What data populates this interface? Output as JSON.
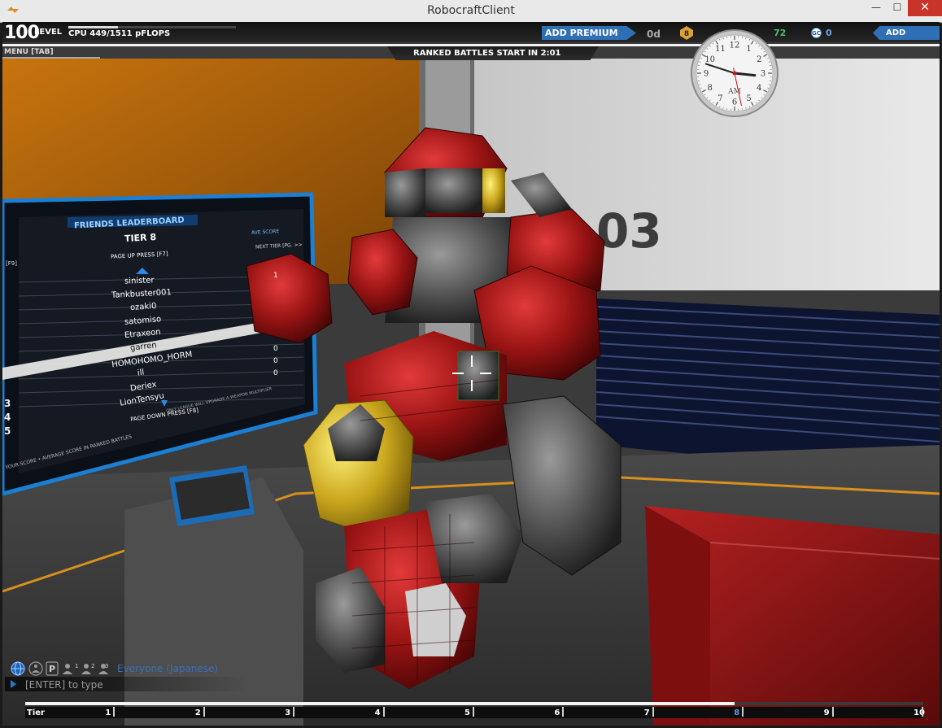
{
  "window": {
    "title": "RobocraftClient",
    "minimize_glyph": "—",
    "maximize_glyph": "☐",
    "close_glyph": "✕",
    "icon": "robocraft-app-icon"
  },
  "hud": {
    "level_number": "100",
    "level_label": "LEVEL",
    "cpu_text": "CPU 449/1511 pFLOPS",
    "cpu_used": 449,
    "cpu_max": 1511,
    "menu_label": "MENU [TAB]",
    "ranked_text": "RANKED BATTLES START IN  2:01",
    "add_premium_label": "ADD PREMIUM",
    "premium_days": "0d",
    "rank_badge_value": "8",
    "robits_value": "72",
    "gc_label": "GC",
    "gc_value": "0",
    "add_funds_label": "ADD FUNDS",
    "accent_color": "#2f6fb5"
  },
  "clock": {
    "label": "AM",
    "numerals": [
      "12",
      "1",
      "2",
      "3",
      "4",
      "5",
      "6",
      "7",
      "8",
      "9",
      "10",
      "11"
    ],
    "hour_hand_hour": 3.2,
    "minute_hand_minute": 48,
    "second_hand_second": 28
  },
  "scene_labels": {
    "wall_number": "03"
  },
  "leaderboard": {
    "title": "FRIENDS LEADERBOARD",
    "tier": "TIER 8",
    "avg_score_label": "AVE SCORE",
    "next_tier_label": "NEXT TIER [PG. >>",
    "page_up_label": "PAGE UP PRESS  [F7]",
    "f9_label": "[F9]",
    "page_down_label": "PAGE DOWN PRESS  [F8]",
    "your_score_label": "YOUR SCORE • AVERAGE SCORE IN RANKED BATTLES",
    "footer_note": "ONLY LEAGUE WILL UPGRADE A WEAPON MULTIPLIER",
    "entries": [
      {
        "name": "sinister",
        "score": "1"
      },
      {
        "name": "Tankbuster001",
        "score": ""
      },
      {
        "name": "ozaki0",
        "score": ""
      },
      {
        "name": "satomiso",
        "score": ""
      },
      {
        "name": "Etraxeon",
        "score": ""
      },
      {
        "name": "garren",
        "score": ""
      },
      {
        "name": "HOMOHOMO_HORM",
        "score": "0"
      },
      {
        "name": "ill",
        "score": "0"
      },
      {
        "name": "Deriex",
        "score": "0"
      },
      {
        "name": "LionTensyu",
        "score": ""
      }
    ],
    "visible_ranks": [
      "3",
      "4",
      "5"
    ]
  },
  "chat": {
    "channel": "Everyone (Japanese)",
    "input_placeholder": "[ENTER] to type",
    "icons": [
      "globe-icon",
      "friends-icon",
      "party-icon",
      "user-1-icon",
      "user-2-icon",
      "user-3-icon"
    ],
    "icon_badges": [
      "P",
      "1",
      "2",
      "3"
    ]
  },
  "tier_bar": {
    "labels": [
      "Tier",
      "1",
      "2",
      "3",
      "4",
      "5",
      "6",
      "7",
      "8",
      "9",
      "10"
    ],
    "current_tier": "8",
    "progress": 0.79
  }
}
